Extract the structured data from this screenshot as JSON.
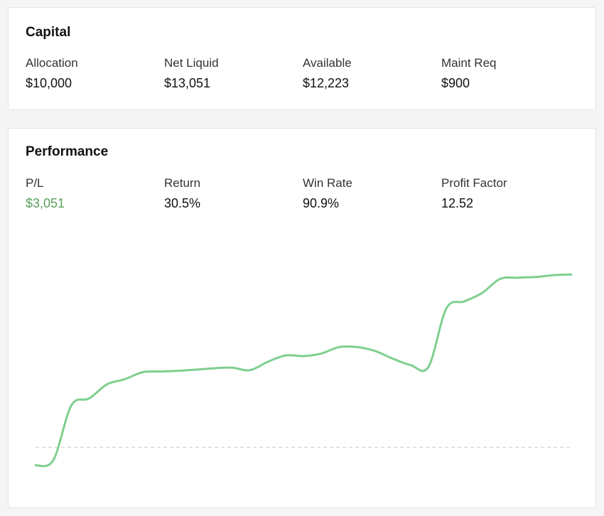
{
  "capital": {
    "title": "Capital",
    "stats": [
      {
        "label": "Allocation",
        "value": "$10,000"
      },
      {
        "label": "Net Liquid",
        "value": "$13,051"
      },
      {
        "label": "Available",
        "value": "$12,223"
      },
      {
        "label": "Maint Req",
        "value": "$900"
      }
    ]
  },
  "performance": {
    "title": "Performance",
    "stats": [
      {
        "label": "P/L",
        "value": "$3,051"
      },
      {
        "label": "Return",
        "value": "30.5%"
      },
      {
        "label": "Win Rate",
        "value": "90.9%"
      },
      {
        "label": "Profit Factor",
        "value": "12.52"
      }
    ]
  },
  "colors": {
    "positive": "#5a9e5c",
    "line": "#7fcf8f",
    "baseline": "#cccccc"
  },
  "chart_data": {
    "type": "line",
    "title": "",
    "xlabel": "",
    "ylabel": "",
    "baseline": 0,
    "ylim": [
      -350,
      3300
    ],
    "grid": false,
    "legend": "none",
    "x": [
      0,
      1,
      2,
      3,
      4,
      5,
      6,
      7,
      8,
      9,
      10,
      11,
      12,
      13,
      14,
      15,
      16,
      17,
      18,
      19,
      20,
      21,
      22,
      23,
      24,
      25,
      26,
      27,
      28,
      29,
      30
    ],
    "series": [
      {
        "values": [
          -280,
          -200,
          650,
          760,
          980,
          1060,
          1170,
          1180,
          1190,
          1210,
          1230,
          1240,
          1200,
          1330,
          1430,
          1420,
          1460,
          1560,
          1560,
          1500,
          1380,
          1280,
          1250,
          2160,
          2270,
          2400,
          2620,
          2640,
          2650,
          2680,
          2690
        ]
      }
    ]
  }
}
